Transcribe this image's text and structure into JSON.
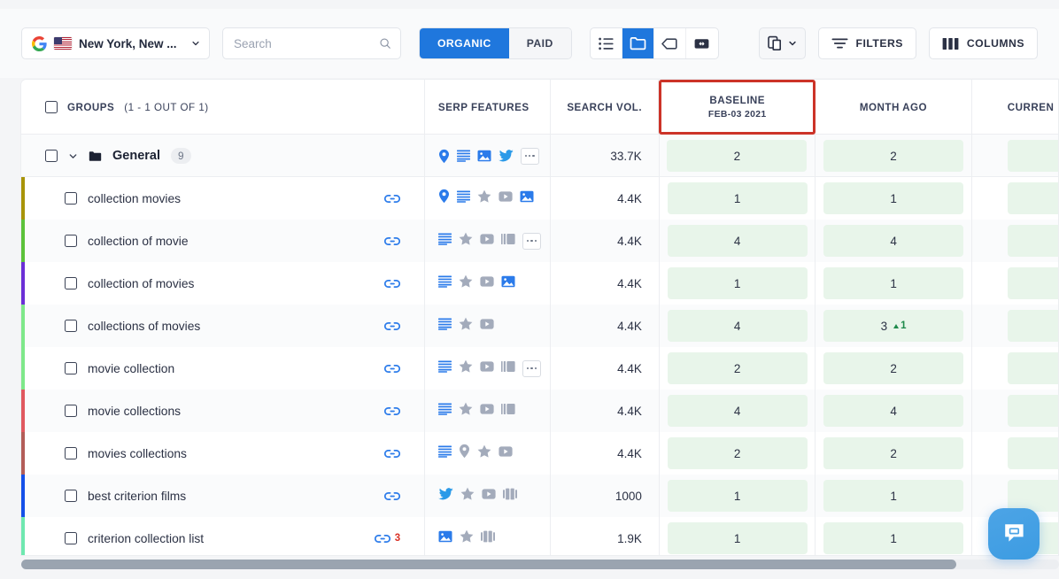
{
  "toolbar": {
    "location": "New York, New ...",
    "google_icon": "google-g-icon",
    "flag_icon": "us-flag-icon",
    "chevron_icon": "chevron-down-icon",
    "search_placeholder": "Search",
    "search_value": "",
    "search_icon": "search-icon",
    "segments": [
      {
        "label": "ORGANIC",
        "active": true
      },
      {
        "label": "PAID",
        "active": false
      }
    ],
    "views": [
      {
        "icon": "list-view-icon",
        "active": false
      },
      {
        "icon": "folder-view-icon",
        "active": true
      },
      {
        "icon": "tag-view-icon",
        "active": false
      },
      {
        "icon": "link-view-icon",
        "active": false
      }
    ],
    "copy_button": {
      "icon": "copy-icon",
      "chevron": "chevron-down-icon"
    },
    "filters": {
      "label": "FILTERS",
      "icon": "filter-icon"
    },
    "columns": {
      "label": "COLUMNS",
      "icon": "columns-icon"
    }
  },
  "table": {
    "headers": {
      "groups": "GROUPS",
      "groups_count": "(1 - 1 OUT OF 1)",
      "serp_features": "SERP FEATURES",
      "search_vol": "SEARCH VOL.",
      "baseline": "BASELINE",
      "baseline_date": "FEB-03 2021",
      "month_ago": "MONTH AGO",
      "current": "CURREN"
    },
    "highlight_color": "#cc3328",
    "group": {
      "name": "General",
      "count": "9",
      "search_vol": "33.7K",
      "baseline": "2",
      "month_ago": "2",
      "serp": [
        "map-pin-icon",
        "snippet-icon",
        "image-icon",
        "twitter-icon"
      ],
      "has_overflow": true
    },
    "rows": [
      {
        "keyword": "collection movies",
        "bar": "#a89409",
        "search_vol": "4.4K",
        "baseline": "1",
        "month_ago": "1",
        "month_delta": "",
        "links": "",
        "serp": [
          "map-pin-icon",
          "snippet-icon",
          "star-icon",
          "video-icon",
          "image-icon"
        ],
        "overflow": false
      },
      {
        "keyword": "collection of movie",
        "bar": "#5cc23a",
        "search_vol": "4.4K",
        "baseline": "4",
        "month_ago": "4",
        "month_delta": "",
        "links": "",
        "serp": [
          "snippet-icon",
          "star-icon",
          "video-icon",
          "carousel-icon"
        ],
        "overflow": true
      },
      {
        "keyword": "collection of movies",
        "bar": "#6b2fd6",
        "search_vol": "4.4K",
        "baseline": "1",
        "month_ago": "1",
        "month_delta": "",
        "links": "",
        "serp": [
          "snippet-icon",
          "star-icon",
          "video-icon",
          "image-icon"
        ],
        "overflow": false
      },
      {
        "keyword": "collections of movies",
        "bar": "#7ee88a",
        "search_vol": "4.4K",
        "baseline": "4",
        "month_ago": "3",
        "month_delta": "1",
        "links": "",
        "serp": [
          "snippet-icon",
          "star-icon",
          "video-icon"
        ],
        "overflow": false
      },
      {
        "keyword": "movie collection",
        "bar": "#7ee88a",
        "search_vol": "4.4K",
        "baseline": "2",
        "month_ago": "2",
        "month_delta": "",
        "links": "",
        "serp": [
          "snippet-icon",
          "star-icon",
          "video-icon",
          "carousel-icon"
        ],
        "overflow": true
      },
      {
        "keyword": "movie collections",
        "bar": "#e0585f",
        "search_vol": "4.4K",
        "baseline": "4",
        "month_ago": "4",
        "month_delta": "",
        "links": "",
        "serp": [
          "snippet-icon",
          "star-icon",
          "video-icon",
          "carousel-icon"
        ],
        "overflow": false
      },
      {
        "keyword": "movies collections",
        "bar": "#b35d58",
        "search_vol": "4.4K",
        "baseline": "2",
        "month_ago": "2",
        "month_delta": "",
        "links": "",
        "serp": [
          "snippet-icon",
          "map-pin-gray-icon",
          "star-icon",
          "video-icon"
        ],
        "overflow": false
      },
      {
        "keyword": "best criterion films",
        "bar": "#1450e8",
        "search_vol": "1000",
        "baseline": "1",
        "month_ago": "1",
        "month_delta": "",
        "links": "",
        "serp": [
          "twitter-icon",
          "star-icon",
          "video-icon",
          "gallery-icon"
        ],
        "overflow": false
      },
      {
        "keyword": "criterion collection list",
        "bar": "#6fe8b0",
        "search_vol": "1.9K",
        "baseline": "1",
        "month_ago": "1",
        "month_delta": "",
        "links": "3",
        "serp": [
          "image-icon",
          "star-icon",
          "gallery-icon"
        ],
        "overflow": false
      }
    ]
  },
  "scrollbar": {
    "name": "horizontal-scrollbar"
  },
  "chat": {
    "icon": "chat-bubble-icon"
  }
}
